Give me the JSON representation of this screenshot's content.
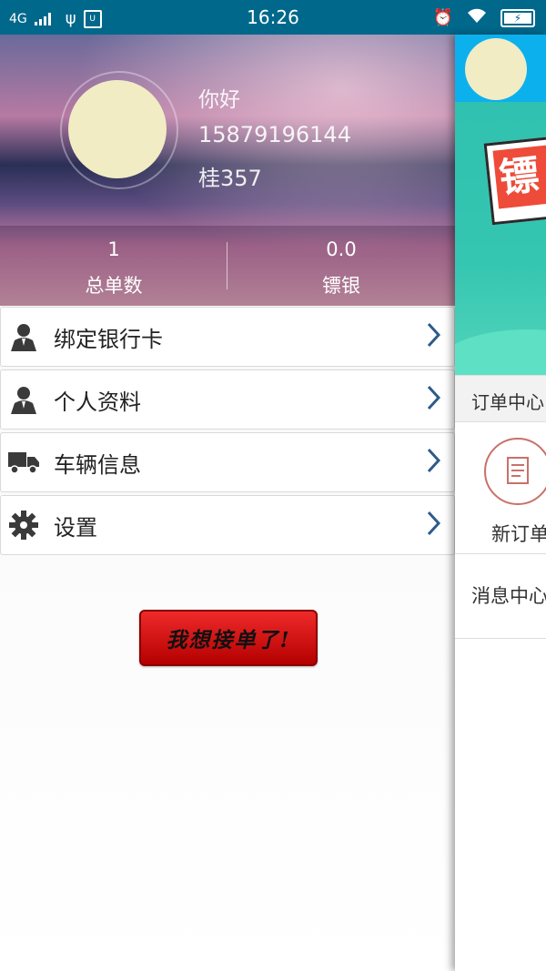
{
  "status_bar": {
    "network": "4G",
    "time": "16:26",
    "battery_icon": "battery-charging-icon"
  },
  "profile": {
    "greeting": "你好",
    "phone": "15879196144",
    "plate": "桂357"
  },
  "stats": [
    {
      "value": "1",
      "label": "总单数"
    },
    {
      "value": "0.0",
      "label": "镖银"
    }
  ],
  "menu": [
    {
      "label": "绑定银行卡",
      "icon": "user-icon"
    },
    {
      "label": "个人资料",
      "icon": "user-icon"
    },
    {
      "label": "车辆信息",
      "icon": "truck-icon"
    },
    {
      "label": "设置",
      "icon": "gear-icon"
    }
  ],
  "action_button": {
    "label": "我想接单了!"
  },
  "main_panel": {
    "banner_text": "镖",
    "order_center": "订单中心",
    "new_order": "新订单",
    "message_center": "消息中心"
  },
  "colors": {
    "status_bar": "#00688b",
    "accent_blue": "#0cb0ed",
    "button_red": "#d41414",
    "chevron": "#2d5b8a"
  }
}
